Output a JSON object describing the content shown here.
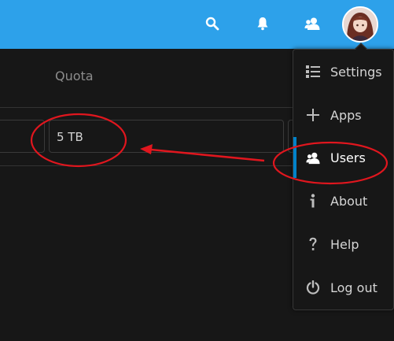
{
  "header": {
    "background": "#2da1ea",
    "icons": [
      "search-icon",
      "notifications-icon",
      "contacts-icon"
    ],
    "avatar": "user-avatar"
  },
  "users_table": {
    "quota_header": "Quota",
    "quota_value": "5 TB"
  },
  "menu": {
    "items": [
      {
        "label": "Settings",
        "icon": "settings-icon"
      },
      {
        "label": "Apps",
        "icon": "plus-icon"
      },
      {
        "label": "Users",
        "icon": "users-icon",
        "active": true
      },
      {
        "label": "About",
        "icon": "info-icon"
      },
      {
        "label": "Help",
        "icon": "help-icon"
      },
      {
        "label": "Log out",
        "icon": "power-icon"
      }
    ],
    "active_color": "#0082c9"
  },
  "annotation_color": "#e0161e"
}
